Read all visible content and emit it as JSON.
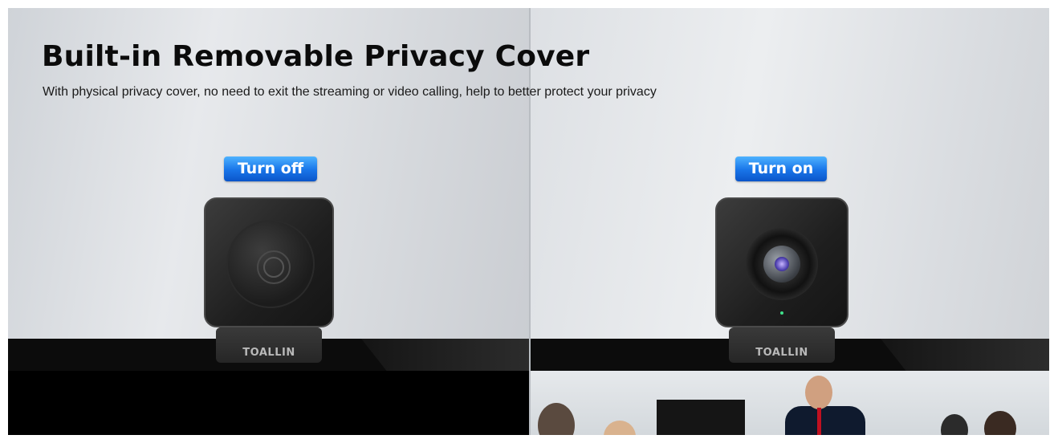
{
  "banner": {
    "title": "Built-in Removable Privacy Cover",
    "subtitle": "With physical privacy cover, no need to exit the streaming or video calling, help to better protect your privacy"
  },
  "panels": {
    "left": {
      "tag": "Turn off",
      "brand": "TOALLIN"
    },
    "right": {
      "tag": "Turn on",
      "brand": "TOALLIN"
    }
  },
  "colors": {
    "tag_top": "#4db2ff",
    "tag_bottom": "#0b55c9",
    "title_text": "#0b0b0b"
  }
}
